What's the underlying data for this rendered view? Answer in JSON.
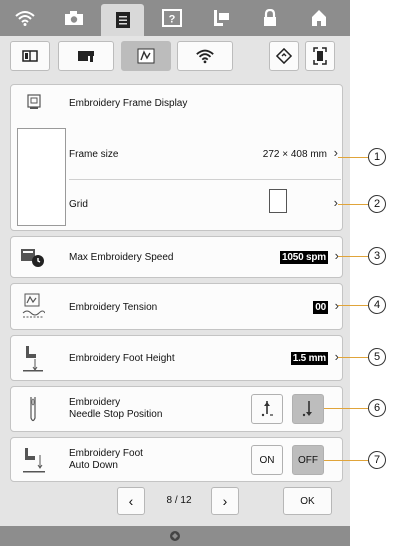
{
  "top_tabs": [
    {
      "icon": "wifi-icon"
    },
    {
      "icon": "camera-icon"
    },
    {
      "icon": "document-icon",
      "active": true
    },
    {
      "icon": "help-icon"
    },
    {
      "icon": "needle-foot-icon"
    },
    {
      "icon": "lock-icon"
    },
    {
      "icon": "home-icon"
    }
  ],
  "sub_tabs": [
    {
      "icon": "book-icon"
    },
    {
      "icon": "sewing-machine-icon"
    },
    {
      "icon": "embroidery-icon",
      "active": true
    },
    {
      "icon": "wifi-icon"
    },
    {
      "icon": "reset-icon"
    },
    {
      "icon": "screen-capture-icon"
    }
  ],
  "frame_display": {
    "title": "Embroidery Frame Display",
    "frame_size_label": "Frame size",
    "frame_size_value": "272 × 408 mm",
    "grid_label": "Grid"
  },
  "max_speed": {
    "label": "Max Embroidery Speed",
    "value": "1050 spm"
  },
  "tension": {
    "label": "Embroidery Tension",
    "value": "00"
  },
  "foot_height": {
    "label": "Embroidery Foot Height",
    "value": "1.5 mm"
  },
  "needle_stop": {
    "label_line1": "Embroidery",
    "label_line2": "Needle Stop Position"
  },
  "auto_down": {
    "label_line1": "Embroidery Foot",
    "label_line2": "Auto Down",
    "on_label": "ON",
    "off_label": "OFF",
    "selected": "OFF"
  },
  "pager": {
    "current": "8",
    "separator": "/",
    "total": "12",
    "ok_label": "OK"
  },
  "callouts": [
    "1",
    "2",
    "3",
    "4",
    "5",
    "6",
    "7"
  ],
  "colors": {
    "callout_line": "#e0a43a",
    "topbar": "#8d8d8d",
    "panel": "#e4e4e4"
  }
}
